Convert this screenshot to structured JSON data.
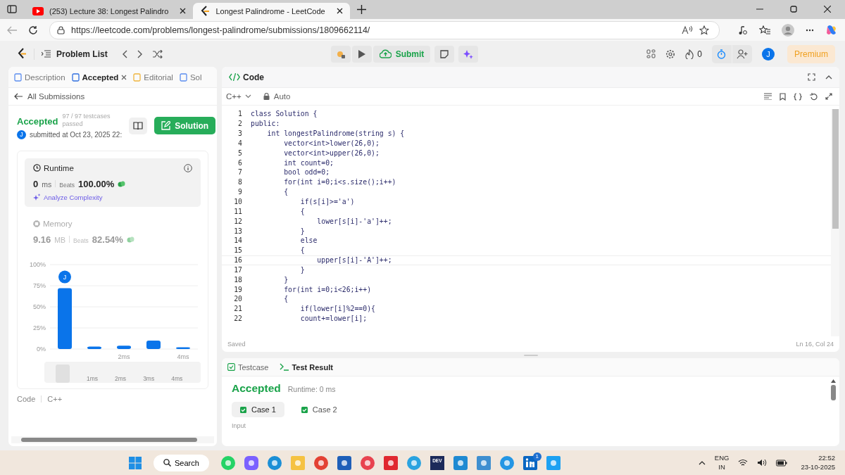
{
  "browser": {
    "tabs": [
      {
        "title": "(253) Lecture 38: Longest Palindro",
        "selected": false,
        "kind": "video"
      },
      {
        "title": "Longest Palindrome - LeetCode",
        "selected": true,
        "kind": "site"
      }
    ],
    "url": "https://leetcode.com/problems/longest-palindrome/submissions/1809662114/"
  },
  "toolbar": {
    "problem_list": "Problem List",
    "submit": "Submit",
    "streak": "0",
    "avatar": "J",
    "premium": "Premium"
  },
  "left": {
    "tabs": [
      {
        "label": "Description",
        "selected": false,
        "kind": "doc"
      },
      {
        "label": "Accepted",
        "selected": true,
        "kind": "history"
      },
      {
        "label": "Editorial",
        "selected": false,
        "kind": "book"
      },
      {
        "label": "Sol",
        "selected": false,
        "kind": "flask"
      }
    ],
    "back": "All Submissions",
    "status": "Accepted",
    "testcases": "97 / 97 testcases passed",
    "submitted": "submitted at Oct 23, 2025 22:",
    "avatar": "J",
    "solution": "Solution",
    "runtime": {
      "label": "Runtime",
      "value": "0",
      "unit": "ms",
      "beats": "Beats",
      "percent": "100.00%",
      "analyze": "Analyze Complexity"
    },
    "memory": {
      "label": "Memory",
      "value": "9.16",
      "unit": "MB",
      "beats": "Beats",
      "percent": "82.54%"
    },
    "chart_marker": "J",
    "chart_data": {
      "type": "bar",
      "x": [
        0,
        1,
        2,
        3,
        4
      ],
      "series": [
        {
          "color": "#0a74ea",
          "values": [
            72,
            3,
            4,
            10,
            2
          ]
        }
      ],
      "grid": true,
      "xlim": [
        -0.5,
        4.5
      ],
      "ylim": [
        0,
        100
      ],
      "yticks": [
        {
          "value": 0,
          "label": "0%"
        },
        {
          "value": 25,
          "label": "25%"
        },
        {
          "value": 50,
          "label": "50%"
        },
        {
          "value": 75,
          "label": "75%"
        },
        {
          "value": 100,
          "label": "100%"
        }
      ],
      "xticks": [
        {
          "value": 2,
          "label": "2ms"
        },
        {
          "value": 4,
          "label": "4ms"
        }
      ]
    },
    "range_labels": [
      "1ms",
      "2ms",
      "3ms",
      "4ms"
    ],
    "footer_code": "Code",
    "footer_lang": "C++"
  },
  "code": {
    "title": "Code",
    "language": "C++",
    "mode": "Auto",
    "lines": [
      {
        "number": "1",
        "text": "class Solution {",
        "selected": false
      },
      {
        "number": "2",
        "text": "public:",
        "selected": false
      },
      {
        "number": "3",
        "text": "    int longestPalindrome(string s) {",
        "selected": false
      },
      {
        "number": "4",
        "text": "        vector<int>lower(26,0);",
        "selected": false
      },
      {
        "number": "5",
        "text": "        vector<int>upper(26,0);",
        "selected": false
      },
      {
        "number": "6",
        "text": "        int count=0;",
        "selected": false
      },
      {
        "number": "7",
        "text": "        bool odd=0;",
        "selected": false
      },
      {
        "number": "8",
        "text": "        for(int i=0;i<s.size();i++)",
        "selected": false
      },
      {
        "number": "9",
        "text": "        {",
        "selected": false
      },
      {
        "number": "10",
        "text": "            if(s[i]>='a')",
        "selected": false
      },
      {
        "number": "11",
        "text": "            {",
        "selected": false
      },
      {
        "number": "12",
        "text": "                lower[s[i]-'a']++;",
        "selected": false
      },
      {
        "number": "13",
        "text": "            }",
        "selected": false
      },
      {
        "number": "14",
        "text": "            else",
        "selected": false
      },
      {
        "number": "15",
        "text": "            {",
        "selected": false
      },
      {
        "number": "16",
        "text": "                upper[s[i]-'A']++;",
        "selected": true
      },
      {
        "number": "17",
        "text": "            }",
        "selected": false
      },
      {
        "number": "18",
        "text": "        }",
        "selected": false
      },
      {
        "number": "19",
        "text": "        for(int i=0;i<26;i++)",
        "selected": false
      },
      {
        "number": "20",
        "text": "        {",
        "selected": false
      },
      {
        "number": "21",
        "text": "            if(lower[i]%2==0){",
        "selected": false
      },
      {
        "number": "22",
        "text": "            count+=lower[i];",
        "selected": false
      }
    ],
    "saved": "Saved",
    "position": "Ln 16, Col 24"
  },
  "test": {
    "tabs": [
      {
        "label": "Testcase",
        "selected": false,
        "kind": "check"
      },
      {
        "label": "Test Result",
        "selected": true,
        "kind": "terminal"
      }
    ],
    "result": "Accepted",
    "runtime": "Runtime: 0 ms",
    "cases": [
      {
        "label": "Case 1",
        "selected": true
      },
      {
        "label": "Case 2",
        "selected": false
      }
    ],
    "input": "Input"
  },
  "taskbar": {
    "search": "Search",
    "dev_label": "DEV",
    "badge": "1",
    "lang": "ENG",
    "region": "IN",
    "time": "22:52",
    "date": "23-10-2025"
  }
}
